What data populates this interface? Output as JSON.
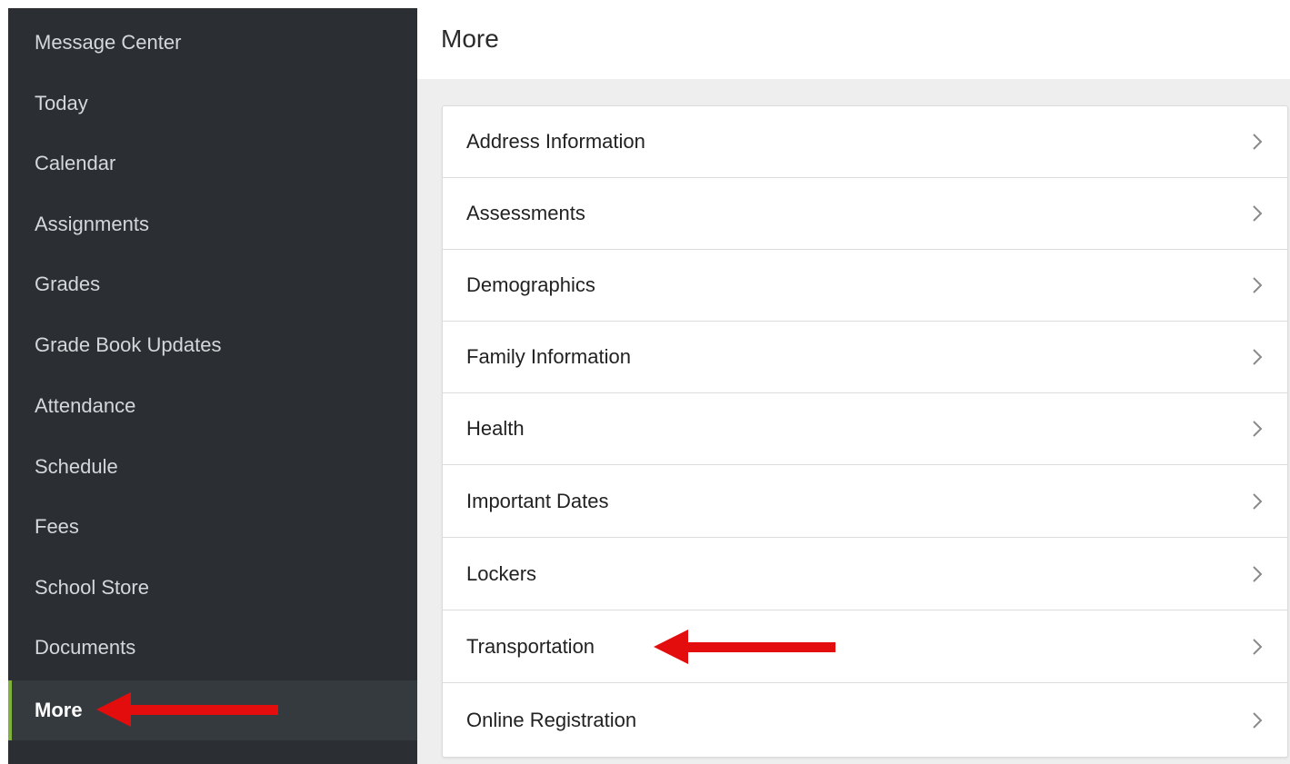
{
  "sidebar": {
    "items": [
      {
        "label": "Message Center"
      },
      {
        "label": "Today"
      },
      {
        "label": "Calendar"
      },
      {
        "label": "Assignments"
      },
      {
        "label": "Grades"
      },
      {
        "label": "Grade Book Updates"
      },
      {
        "label": "Attendance"
      },
      {
        "label": "Schedule"
      },
      {
        "label": "Fees"
      },
      {
        "label": "School Store"
      },
      {
        "label": "Documents"
      },
      {
        "label": "More",
        "active": true
      }
    ]
  },
  "main": {
    "title": "More",
    "menu": [
      {
        "label": "Address Information",
        "icon": "chevron-right-icon"
      },
      {
        "label": "Assessments",
        "icon": "chevron-right-icon"
      },
      {
        "label": "Demographics",
        "icon": "chevron-right-icon"
      },
      {
        "label": "Family Information",
        "icon": "chevron-right-icon"
      },
      {
        "label": "Health",
        "icon": "chevron-right-icon"
      },
      {
        "label": "Important Dates",
        "icon": "chevron-right-icon"
      },
      {
        "label": "Lockers",
        "icon": "chevron-right-icon"
      },
      {
        "label": "Transportation",
        "icon": "chevron-right-icon"
      },
      {
        "label": "Online Registration",
        "icon": "chevron-right-icon"
      }
    ]
  },
  "annotations": {
    "arrow_color": "#e30d0d",
    "arrows": [
      {
        "target": "More",
        "icon": "red-arrow-left-icon"
      },
      {
        "target": "Transportation",
        "icon": "red-arrow-left-icon"
      }
    ]
  },
  "colors": {
    "sidebar_bg": "#2b2f33",
    "sidebar_active_bg": "#353a3f",
    "active_accent": "#7fb13c",
    "main_bg": "#eeeeee"
  }
}
